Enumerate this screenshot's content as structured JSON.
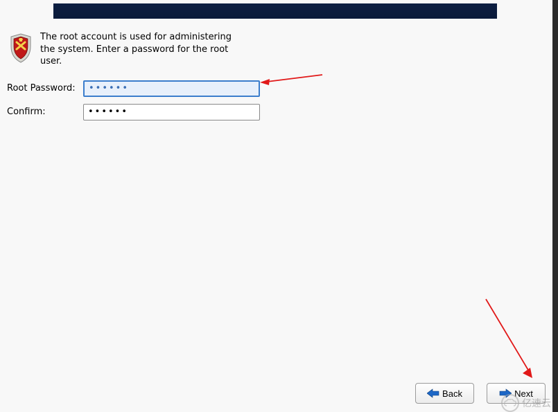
{
  "intro": {
    "text": "The root account is used for administering the system.  Enter a password for the root user."
  },
  "form": {
    "root_password_label": "Root Password:",
    "confirm_label": "Confirm:",
    "root_password_value": "••••••",
    "confirm_value": "••••••"
  },
  "buttons": {
    "back": "Back",
    "next": "Next"
  },
  "watermark": {
    "text": "亿速云"
  },
  "icons": {
    "shield": "shield-icon",
    "back_arrow": "arrow-left-icon",
    "next_arrow": "arrow-right-icon"
  },
  "colors": {
    "header_bg": "#0a1a3a",
    "focus_border": "#3b7dcc",
    "arrow_red": "#e11919",
    "arrow_blue": "#1d67c6"
  }
}
